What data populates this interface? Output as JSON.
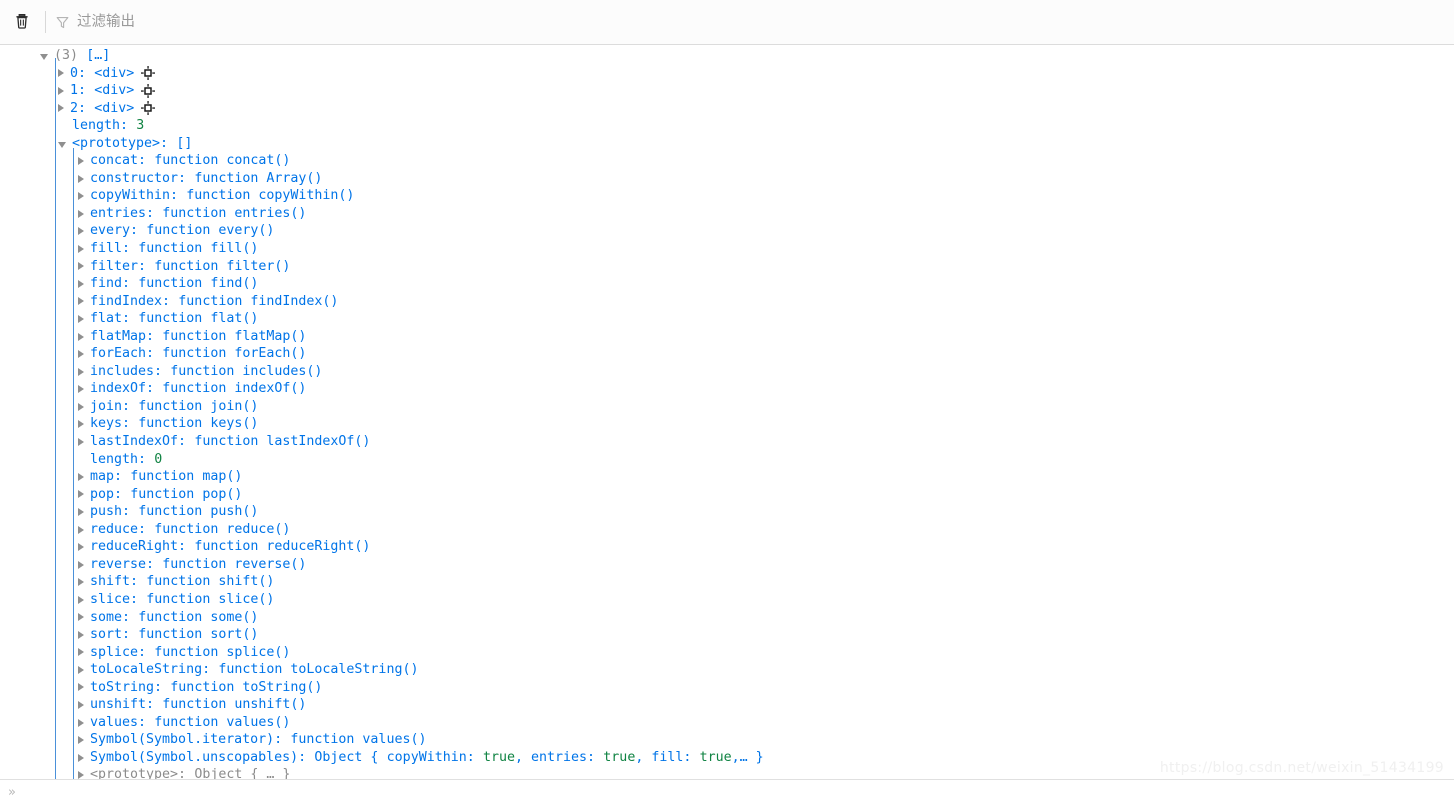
{
  "toolbar": {
    "clear_button_title": "清除",
    "filter": {
      "placeholder": "过滤输出",
      "value": ""
    }
  },
  "console": {
    "root": {
      "count_label": "(3)",
      "preview": "[…]"
    },
    "array_items": [
      {
        "index": "0:",
        "value": "<div>"
      },
      {
        "index": "1:",
        "value": "<div>"
      },
      {
        "index": "2:",
        "value": "<div>"
      }
    ],
    "array_length": {
      "key": "length:",
      "value": "3"
    },
    "prototype_header": {
      "key": "<prototype>:",
      "value": "[]"
    },
    "prototype_props": [
      {
        "key": "concat:",
        "value": "function concat()",
        "expandable": true
      },
      {
        "key": "constructor:",
        "value": "function Array()",
        "expandable": true
      },
      {
        "key": "copyWithin:",
        "value": "function copyWithin()",
        "expandable": true
      },
      {
        "key": "entries:",
        "value": "function entries()",
        "expandable": true
      },
      {
        "key": "every:",
        "value": "function every()",
        "expandable": true
      },
      {
        "key": "fill:",
        "value": "function fill()",
        "expandable": true
      },
      {
        "key": "filter:",
        "value": "function filter()",
        "expandable": true
      },
      {
        "key": "find:",
        "value": "function find()",
        "expandable": true
      },
      {
        "key": "findIndex:",
        "value": "function findIndex()",
        "expandable": true
      },
      {
        "key": "flat:",
        "value": "function flat()",
        "expandable": true
      },
      {
        "key": "flatMap:",
        "value": "function flatMap()",
        "expandable": true
      },
      {
        "key": "forEach:",
        "value": "function forEach()",
        "expandable": true
      },
      {
        "key": "includes:",
        "value": "function includes()",
        "expandable": true
      },
      {
        "key": "indexOf:",
        "value": "function indexOf()",
        "expandable": true
      },
      {
        "key": "join:",
        "value": "function join()",
        "expandable": true
      },
      {
        "key": "keys:",
        "value": "function keys()",
        "expandable": true
      },
      {
        "key": "lastIndexOf:",
        "value": "function lastIndexOf()",
        "expandable": true
      },
      {
        "key": "length:",
        "value": "0",
        "expandable": false,
        "numeric": true
      },
      {
        "key": "map:",
        "value": "function map()",
        "expandable": true
      },
      {
        "key": "pop:",
        "value": "function pop()",
        "expandable": true
      },
      {
        "key": "push:",
        "value": "function push()",
        "expandable": true
      },
      {
        "key": "reduce:",
        "value": "function reduce()",
        "expandable": true
      },
      {
        "key": "reduceRight:",
        "value": "function reduceRight()",
        "expandable": true
      },
      {
        "key": "reverse:",
        "value": "function reverse()",
        "expandable": true
      },
      {
        "key": "shift:",
        "value": "function shift()",
        "expandable": true
      },
      {
        "key": "slice:",
        "value": "function slice()",
        "expandable": true
      },
      {
        "key": "some:",
        "value": "function some()",
        "expandable": true
      },
      {
        "key": "sort:",
        "value": "function sort()",
        "expandable": true
      },
      {
        "key": "splice:",
        "value": "function splice()",
        "expandable": true
      },
      {
        "key": "toLocaleString:",
        "value": "function toLocaleString()",
        "expandable": true
      },
      {
        "key": "toString:",
        "value": "function toString()",
        "expandable": true
      },
      {
        "key": "unshift:",
        "value": "function unshift()",
        "expandable": true
      },
      {
        "key": "values:",
        "value": "function values()",
        "expandable": true
      },
      {
        "key": "Symbol(Symbol.iterator):",
        "value": "function values()",
        "expandable": true
      }
    ],
    "unscopables": {
      "key": "Symbol(Symbol.unscopables):",
      "type": "Object {",
      "pairs": [
        {
          "k": "copyWithin:",
          "v": "true"
        },
        {
          "k": "entries:",
          "v": "true"
        },
        {
          "k": "fill:",
          "v": "true"
        }
      ],
      "tail": "… }"
    },
    "inner_prototype": {
      "key": "<prototype>:",
      "value": "Object { … }"
    }
  },
  "prompt": {
    "chevron": "»",
    "value": ""
  },
  "watermark": {
    "text": "https://blog.csdn.net/weixin_51434199"
  },
  "colors": {
    "property": "#0074e8",
    "number": "#108343",
    "boolean": "#108343",
    "muted": "#8c8c8c",
    "guide": "#4a90d9",
    "toolbar_bg": "#fcfcfc"
  }
}
